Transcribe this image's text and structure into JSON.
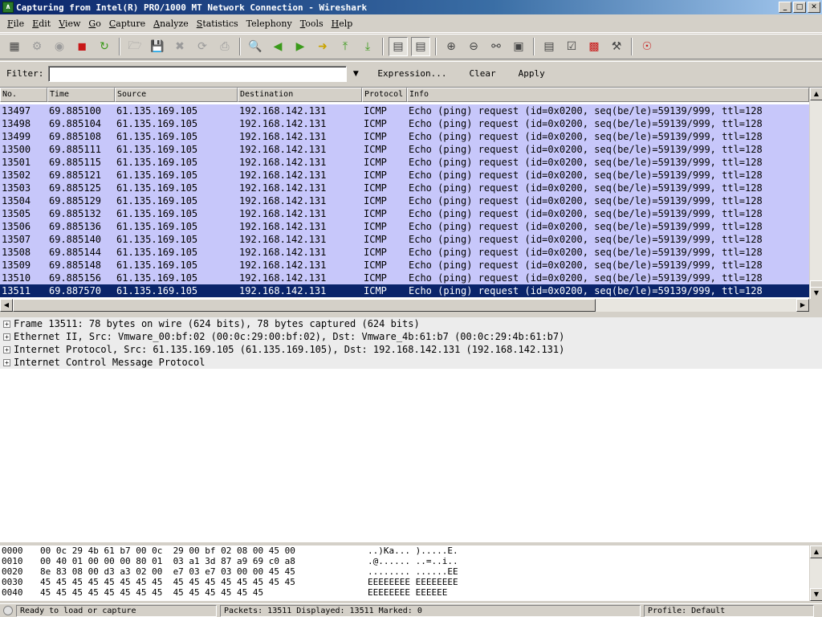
{
  "window": {
    "title": "Capturing from Intel(R) PRO/1000 MT Network Connection - Wireshark",
    "app_icon_glyph": "∧",
    "minimize": "_",
    "maximize": "□",
    "close": "✕"
  },
  "menu": [
    {
      "u": "F",
      "rest": "ile"
    },
    {
      "u": "E",
      "rest": "dit"
    },
    {
      "u": "V",
      "rest": "iew"
    },
    {
      "u": "G",
      "rest": "o"
    },
    {
      "u": "C",
      "rest": "apture"
    },
    {
      "u": "A",
      "rest": "nalyze"
    },
    {
      "u": "S",
      "rest": "tatistics"
    },
    {
      "u": "",
      "rest": "Telephony"
    },
    {
      "u": "T",
      "rest": "ools"
    },
    {
      "u": "H",
      "rest": "elp"
    }
  ],
  "toolbar": {
    "icons": [
      "interface-list-icon",
      "capture-options-icon",
      "capture-start-icon",
      "capture-stop-icon",
      "capture-restart-icon",
      "open-file-icon",
      "save-file-icon",
      "close-file-icon",
      "reload-icon",
      "print-icon",
      "find-packet-icon",
      "go-back-icon",
      "go-forward-icon",
      "go-to-packet-icon",
      "go-first-icon",
      "go-last-icon",
      "colorize-icon",
      "auto-scroll-icon",
      "zoom-in-icon",
      "zoom-out-icon",
      "zoom-normal-icon",
      "resize-columns-icon",
      "capture-filters-icon",
      "display-filters-icon",
      "coloring-rules-icon",
      "preferences-icon",
      "help-icon"
    ]
  },
  "filter": {
    "label": "Filter:",
    "value": "",
    "expression_label": "Expression...",
    "clear_label": "Clear",
    "apply_label": "Apply"
  },
  "packet_list": {
    "columns": [
      "No.",
      "Time",
      "Source",
      "Destination",
      "Protocol",
      "Info"
    ],
    "rows": [
      {
        "no": "13497",
        "time": "69.885100",
        "src": "61.135.169.105",
        "dst": "192.168.142.131",
        "proto": "ICMP",
        "info": "Echo (ping) request  (id=0x0200, seq(be/le)=59139/999, ttl=128"
      },
      {
        "no": "13498",
        "time": "69.885104",
        "src": "61.135.169.105",
        "dst": "192.168.142.131",
        "proto": "ICMP",
        "info": "Echo (ping) request  (id=0x0200, seq(be/le)=59139/999, ttl=128"
      },
      {
        "no": "13499",
        "time": "69.885108",
        "src": "61.135.169.105",
        "dst": "192.168.142.131",
        "proto": "ICMP",
        "info": "Echo (ping) request  (id=0x0200, seq(be/le)=59139/999, ttl=128"
      },
      {
        "no": "13500",
        "time": "69.885111",
        "src": "61.135.169.105",
        "dst": "192.168.142.131",
        "proto": "ICMP",
        "info": "Echo (ping) request  (id=0x0200, seq(be/le)=59139/999, ttl=128"
      },
      {
        "no": "13501",
        "time": "69.885115",
        "src": "61.135.169.105",
        "dst": "192.168.142.131",
        "proto": "ICMP",
        "info": "Echo (ping) request  (id=0x0200, seq(be/le)=59139/999, ttl=128"
      },
      {
        "no": "13502",
        "time": "69.885121",
        "src": "61.135.169.105",
        "dst": "192.168.142.131",
        "proto": "ICMP",
        "info": "Echo (ping) request  (id=0x0200, seq(be/le)=59139/999, ttl=128"
      },
      {
        "no": "13503",
        "time": "69.885125",
        "src": "61.135.169.105",
        "dst": "192.168.142.131",
        "proto": "ICMP",
        "info": "Echo (ping) request  (id=0x0200, seq(be/le)=59139/999, ttl=128"
      },
      {
        "no": "13504",
        "time": "69.885129",
        "src": "61.135.169.105",
        "dst": "192.168.142.131",
        "proto": "ICMP",
        "info": "Echo (ping) request  (id=0x0200, seq(be/le)=59139/999, ttl=128"
      },
      {
        "no": "13505",
        "time": "69.885132",
        "src": "61.135.169.105",
        "dst": "192.168.142.131",
        "proto": "ICMP",
        "info": "Echo (ping) request  (id=0x0200, seq(be/le)=59139/999, ttl=128"
      },
      {
        "no": "13506",
        "time": "69.885136",
        "src": "61.135.169.105",
        "dst": "192.168.142.131",
        "proto": "ICMP",
        "info": "Echo (ping) request  (id=0x0200, seq(be/le)=59139/999, ttl=128"
      },
      {
        "no": "13507",
        "time": "69.885140",
        "src": "61.135.169.105",
        "dst": "192.168.142.131",
        "proto": "ICMP",
        "info": "Echo (ping) request  (id=0x0200, seq(be/le)=59139/999, ttl=128"
      },
      {
        "no": "13508",
        "time": "69.885144",
        "src": "61.135.169.105",
        "dst": "192.168.142.131",
        "proto": "ICMP",
        "info": "Echo (ping) request  (id=0x0200, seq(be/le)=59139/999, ttl=128"
      },
      {
        "no": "13509",
        "time": "69.885148",
        "src": "61.135.169.105",
        "dst": "192.168.142.131",
        "proto": "ICMP",
        "info": "Echo (ping) request  (id=0x0200, seq(be/le)=59139/999, ttl=128"
      },
      {
        "no": "13510",
        "time": "69.885156",
        "src": "61.135.169.105",
        "dst": "192.168.142.131",
        "proto": "ICMP",
        "info": "Echo (ping) request  (id=0x0200, seq(be/le)=59139/999, ttl=128"
      },
      {
        "no": "13511",
        "time": "69.887570",
        "src": "61.135.169.105",
        "dst": "192.168.142.131",
        "proto": "ICMP",
        "info": "Echo (ping) request  (id=0x0200, seq(be/le)=59139/999, ttl=128",
        "selected": true
      }
    ]
  },
  "details": [
    "Frame 13511: 78 bytes on wire (624 bits), 78 bytes captured (624 bits)",
    "Ethernet II, Src: Vmware_00:bf:02 (00:0c:29:00:bf:02), Dst: Vmware_4b:61:b7 (00:0c:29:4b:61:b7)",
    "Internet Protocol, Src: 61.135.169.105 (61.135.169.105), Dst: 192.168.142.131 (192.168.142.131)",
    "Internet Control Message Protocol"
  ],
  "hex": [
    {
      "off": "0000",
      "bytes": "00 0c 29 4b 61 b7 00 0c  29 00 bf 02 08 00 45 00",
      "ascii": "..)Ka... ).....E."
    },
    {
      "off": "0010",
      "bytes": "00 40 01 00 00 00 80 01  03 a1 3d 87 a9 69 c0 a8",
      "ascii": ".@...... ..=..i.."
    },
    {
      "off": "0020",
      "bytes": "8e 83 08 00 d3 a3 02 00  e7 03 e7 03 00 00 45 45",
      "ascii": "........ ......EE"
    },
    {
      "off": "0030",
      "bytes": "45 45 45 45 45 45 45 45  45 45 45 45 45 45 45 45",
      "ascii": "EEEEEEEE EEEEEEEE"
    },
    {
      "off": "0040",
      "bytes": "45 45 45 45 45 45 45 45  45 45 45 45 45 45",
      "ascii": "EEEEEEEE EEEEEE"
    }
  ],
  "status": {
    "ready": "Ready to load or capture",
    "packets": "Packets: 13511 Displayed: 13511 Marked: 0",
    "profile": "Profile: Default"
  },
  "colors": {
    "row_bg": "#c7c7fa",
    "selected_bg": "#0a246a"
  }
}
